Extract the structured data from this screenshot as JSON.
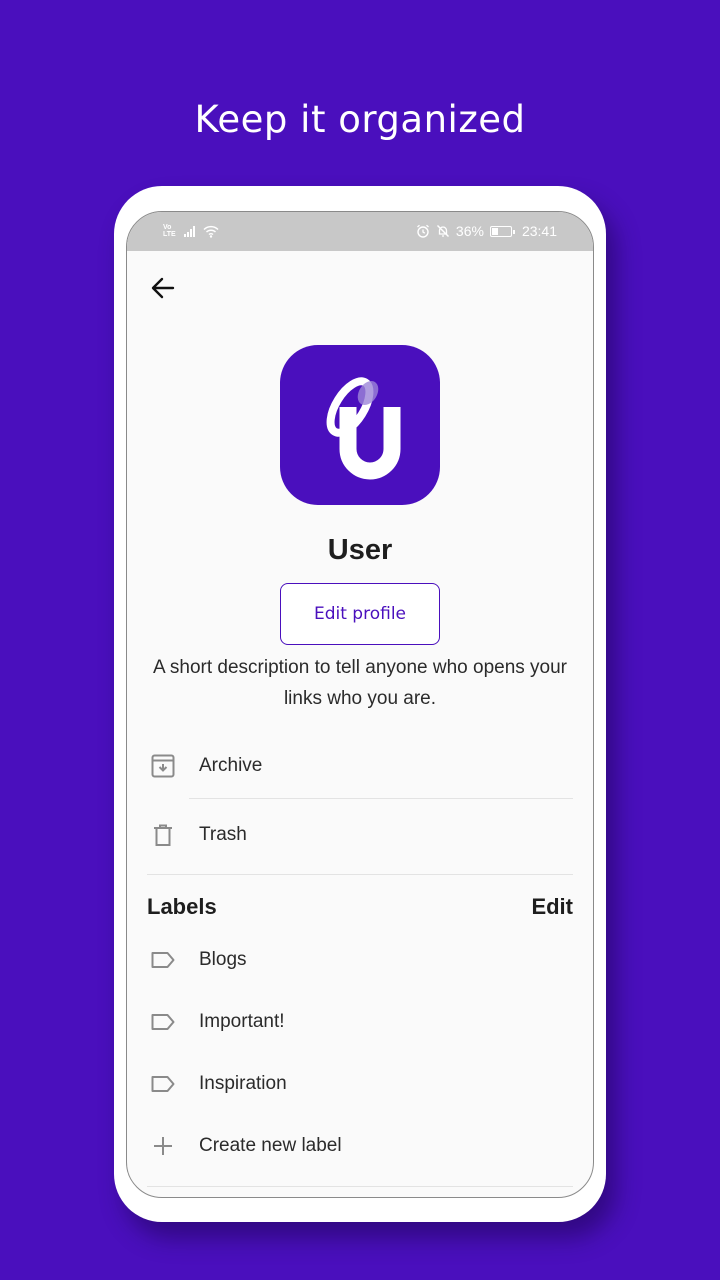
{
  "headline": "Keep it organized",
  "status_bar": {
    "network_top": "Vo",
    "network_bottom": "LTE",
    "battery_percent": "36%",
    "time": "23:41"
  },
  "profile": {
    "app_logo_letter": "U",
    "username": "User",
    "edit_profile_label": "Edit profile",
    "description": "A short description to tell anyone who opens your links who you are."
  },
  "menu": {
    "archive_label": "Archive",
    "trash_label": "Trash"
  },
  "labels_section": {
    "heading": "Labels",
    "edit_label": "Edit",
    "items": [
      {
        "label": "Blogs",
        "icon": "label-tag-icon"
      },
      {
        "label": "Important!",
        "icon": "label-tag-icon"
      },
      {
        "label": "Inspiration",
        "icon": "label-tag-icon"
      }
    ],
    "create_label": "Create new label"
  },
  "colors": {
    "brand_purple": "#4a0fbd",
    "screen_background": "#fafafa",
    "status_bar_gray": "#c8c8c8"
  }
}
